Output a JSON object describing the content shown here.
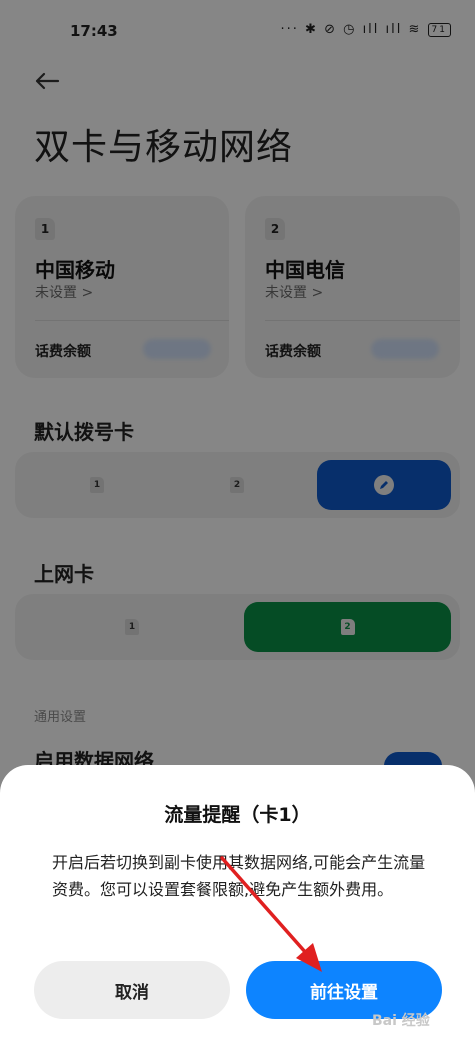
{
  "status_bar": {
    "time": "17:43",
    "icons": "··· ✱ ⊘ ◷ ıll ıll ≋",
    "battery": "71"
  },
  "header": {
    "title": "双卡与移动网络"
  },
  "sims": [
    {
      "slot": "1",
      "carrier": "中国移动",
      "status": "未设置 >",
      "balance_label": "话费余额"
    },
    {
      "slot": "2",
      "carrier": "中国电信",
      "status": "未设置 >",
      "balance_label": "话费余额"
    }
  ],
  "default_call": {
    "title": "默认拨号卡",
    "options": [
      "1",
      "2"
    ]
  },
  "data_sim": {
    "title": "上网卡",
    "options": [
      "1",
      "2"
    ]
  },
  "general": {
    "section_label": "通用设置",
    "data_network_label": "启用数据网络"
  },
  "dialog": {
    "title": "流量提醒（卡1）",
    "body": "开启后若切换到副卡使用其数据网络,可能会产生流量资费。您可以设置套餐限额,避免产生额外费用。",
    "cancel_label": "取消",
    "confirm_label": "前往设置"
  },
  "watermark": "Bai 经验",
  "colors": {
    "accent_blue": "#0e57c4",
    "accent_green": "#0a8a44",
    "confirm_button": "#0d84ff",
    "arrow": "#e02020"
  }
}
